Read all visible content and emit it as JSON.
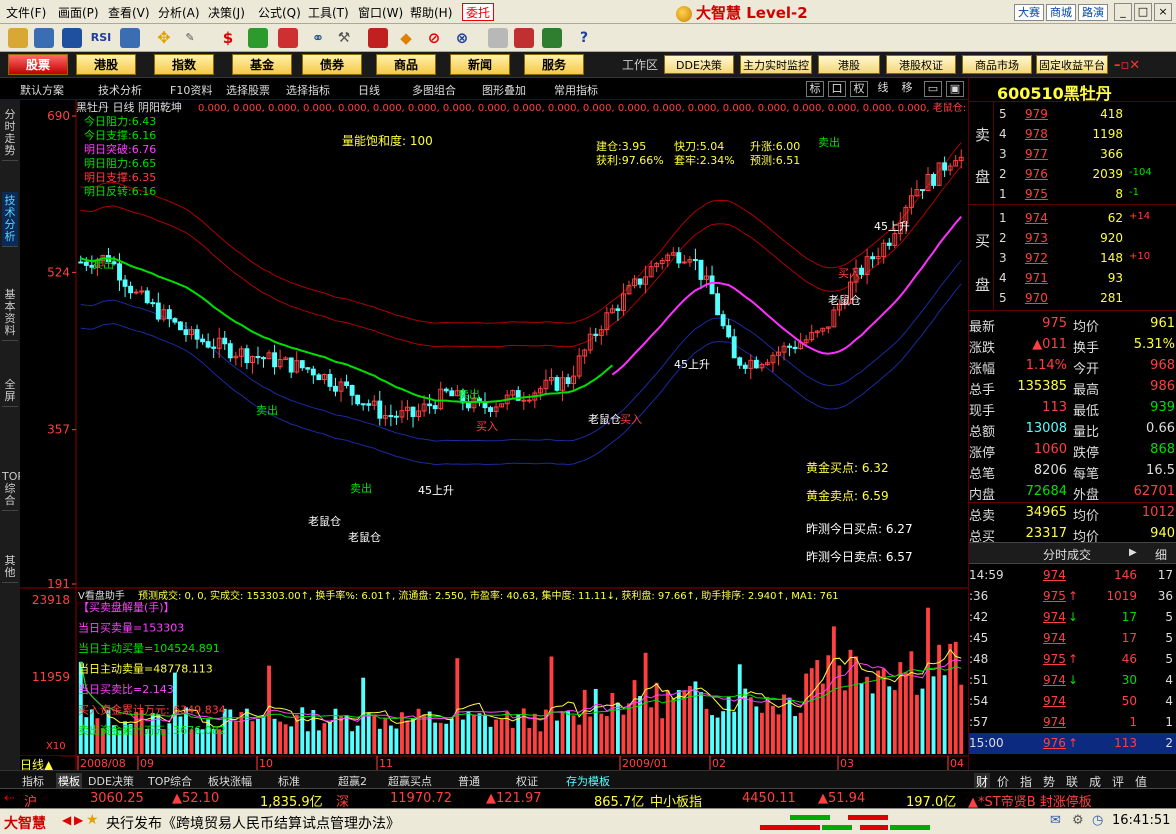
{
  "menu": {
    "items": [
      "文件(F)",
      "画面(P)",
      "查看(V)",
      "分析(A)",
      "决策(J)",
      "公式(Q)",
      "工具(T)",
      "窗口(W)",
      "帮助(H)"
    ],
    "weituo": "委托",
    "brand": "大智慧 Level-2",
    "top_buttons": [
      "大赛",
      "商城",
      "路演"
    ],
    "win_buttons": [
      "_",
      "□",
      "×"
    ]
  },
  "toolbar": {
    "icons": [
      "folder-icon",
      "chart-icon",
      "grid-icon",
      "rsi-icon",
      "calc-icon",
      "move-icon",
      "pen-icon",
      "dollar-icon",
      "eye-icon",
      "binoculars-icon",
      "hammer-icon",
      "alert-icon",
      "diamond-icon",
      "no-icon",
      "disk-icon",
      "copy-icon",
      "layout-icon",
      "books-icon",
      "help-icon"
    ],
    "rsi_label": "RSI",
    "dollar_label": "$"
  },
  "nav": {
    "buttons": [
      "股票",
      "港股",
      "指数",
      "基金",
      "债券",
      "商品",
      "新闻",
      "服务"
    ],
    "active": "股票",
    "workarea": "工作区",
    "buttons2": [
      "DDE决策",
      "主力实时监控",
      "港股",
      "港股权证",
      "商品市场",
      "固定收益平台"
    ]
  },
  "options": {
    "items": [
      "默认方案",
      "技术分析",
      "F10资料",
      "选择股票",
      "选择指标",
      "日线",
      "多图组合",
      "图形叠加",
      "常用指标"
    ],
    "right_buttons": [
      "标",
      "口",
      "权",
      "线",
      "移"
    ]
  },
  "left_tabs": [
    "分时走势",
    "技术分析",
    "基本资料",
    "全屏",
    "TOP综合",
    "其他"
  ],
  "left_tab_active": "技术分析",
  "chart_data": [
    {
      "type": "candlestick",
      "title": "黑牡丹 日线 阴阳乾坤",
      "header_values": "0.000, 0.000, 0.000, 0.000, 0.000, 0.000, 0.000, 0.000, 0.000, 0.000, 0.000, 0.000, 0.000, 0.000, 0.000, 0.000, 0.000, 0.000, 0.000, 0.000, 0.000, 老鼠仓: 0.000, 阴阳",
      "y_ticks": [
        690,
        524,
        357,
        191
      ],
      "ylim": [
        191,
        690
      ],
      "x_ticks": [
        "2008/08",
        "09",
        "10",
        "11",
        "2009/01",
        "02",
        "03",
        "04"
      ],
      "levels": [
        {
          "label": "今日阻力:",
          "value": "6.43",
          "color": "#00e000"
        },
        {
          "label": "今日支撑:",
          "value": "6.16",
          "color": "#00e000"
        },
        {
          "label": "明日突破:",
          "value": "6.76",
          "color": "#ff40ff"
        },
        {
          "label": "明日阻力:",
          "value": "6.65",
          "color": "#00e000"
        },
        {
          "label": "明日支撑:",
          "value": "6.35",
          "color": "#ff4040"
        },
        {
          "label": "明日反转:",
          "value": "6.16",
          "color": "#00e000"
        }
      ],
      "saturation": "量能饱和度: 100",
      "info_box": {
        "jiancang": "建仓:3.95",
        "kuaidao": "快刀:5.04",
        "shengzhang": "升涨:6.00",
        "huoli": "获利:97.66%",
        "taolao": "套牢:2.34%",
        "yuce": "预测:6.51"
      },
      "signals": {
        "sell": "卖出",
        "buy": "买入",
        "rat": "老鼠仓",
        "rise": "45上升"
      },
      "gold": {
        "buy": "黄金买点: 6.32",
        "sell": "黄金卖点: 6.59",
        "prev_buy": "昨测今日买点: 6.27",
        "prev_sell": "昨测今日卖点: 6.57"
      },
      "series_colors": {
        "up": "#ff4040",
        "down": "#54ffff",
        "ma_green": "#00e000",
        "ma_magenta": "#ff30ff",
        "band_red": "#b00000",
        "band_blue": "#1a2aa0"
      }
    },
    {
      "type": "bar",
      "title": "V看盘助手",
      "header": "预测成交: 0, 0, 实成交: 153303.00↑, 换手率%: 6.01↑, 流通盘: 2.550, 市盈率: 40.63, 集中度: 11.11↓, 获利盘: 97.66↑, 助手排序: 2.940↑, MA1: 761",
      "y_ticks": [
        23918,
        11959
      ],
      "ylim": [
        0,
        23918
      ],
      "scale_label": "X10",
      "lines": [
        {
          "text": "【买卖盘解量(手)】",
          "color": "#ff40ff"
        },
        {
          "text": "当日买卖量=153303",
          "color": "#ff40ff"
        },
        {
          "text": "当日主动买量=104524.891",
          "color": "#00e000"
        },
        {
          "text": "当日主动卖量=48778.113",
          "color": "#ffff40"
        },
        {
          "text": "当日买卖比=2.143",
          "color": "#ff40ff"
        },
        {
          "text": "买入资金累计万元: 6349.834",
          "color": "#ff4040"
        },
        {
          "text": "卖出资金累计万元: 3676.082",
          "color": "#00e000"
        }
      ]
    }
  ],
  "stock": {
    "code": "600510",
    "name": "黑牡丹"
  },
  "orderbook": {
    "sell_label": [
      "卖",
      "盘"
    ],
    "buy_label": [
      "买",
      "盘"
    ],
    "sells": [
      {
        "level": "5",
        "price": "979",
        "vol": "418",
        "chg": ""
      },
      {
        "level": "4",
        "price": "978",
        "vol": "1198",
        "chg": ""
      },
      {
        "level": "3",
        "price": "977",
        "vol": "366",
        "chg": ""
      },
      {
        "level": "2",
        "price": "976",
        "vol": "2039",
        "chg": "-104"
      },
      {
        "level": "1",
        "price": "975",
        "vol": "8",
        "chg": "-1"
      }
    ],
    "buys": [
      {
        "level": "1",
        "price": "974",
        "vol": "62",
        "chg": "+14"
      },
      {
        "level": "2",
        "price": "973",
        "vol": "920",
        "chg": ""
      },
      {
        "level": "3",
        "price": "972",
        "vol": "148",
        "chg": "+10"
      },
      {
        "level": "4",
        "price": "971",
        "vol": "93",
        "chg": ""
      },
      {
        "level": "5",
        "price": "970",
        "vol": "281",
        "chg": ""
      }
    ]
  },
  "quotes": [
    {
      "l1": "最新",
      "v1": "975",
      "c1": "#ff4040",
      "l2": "均价",
      "v2": "961",
      "c2": "#ffff40"
    },
    {
      "l1": "涨跌",
      "v1": "▲011",
      "c1": "#ff4040",
      "l2": "换手",
      "v2": "5.31%",
      "c2": "#ffff40"
    },
    {
      "l1": "涨幅",
      "v1": "1.14%",
      "c1": "#ff4040",
      "l2": "今开",
      "v2": "968",
      "c2": "#ff4040"
    },
    {
      "l1": "总手",
      "v1": "135385",
      "c1": "#ffff40",
      "l2": "最高",
      "v2": "986",
      "c2": "#ff4040"
    },
    {
      "l1": "现手",
      "v1": "113",
      "c1": "#ff4040",
      "l2": "最低",
      "v2": "939",
      "c2": "#00e000"
    },
    {
      "l1": "总额",
      "v1": "13008",
      "c1": "#54ffff",
      "l2": "量比",
      "v2": "0.66",
      "c2": "#ddd"
    },
    {
      "l1": "涨停",
      "v1": "1060",
      "c1": "#ff4040",
      "l2": "跌停",
      "v2": "868",
      "c2": "#00e000"
    },
    {
      "l1": "总笔",
      "v1": "8206",
      "c1": "#ddd",
      "l2": "每笔",
      "v2": "16.5",
      "c2": "#ddd"
    },
    {
      "l1": "内盘",
      "v1": "72684",
      "c1": "#00e000",
      "l2": "外盘",
      "v2": "62701",
      "c2": "#ff4040"
    },
    {
      "l1": "总卖",
      "v1": "34965",
      "c1": "#ffff40",
      "l2": "均价",
      "v2": "1012",
      "c2": "#ff4040"
    },
    {
      "l1": "总买",
      "v1": "23317",
      "c1": "#ffff40",
      "l2": "均价",
      "v2": "940",
      "c2": "#ffff40"
    }
  ],
  "trades": {
    "title": "分时成交",
    "title_btn": "细",
    "rows": [
      {
        "time": "14:59",
        "price": "974",
        "arrow": "",
        "vol": "146",
        "n": "17"
      },
      {
        "time": ":36",
        "price": "975",
        "arrow": "↑",
        "vol": "1019",
        "n": "36"
      },
      {
        "time": ":42",
        "price": "974",
        "arrow": "↓",
        "vol": "17",
        "n": "5"
      },
      {
        "time": ":45",
        "price": "974",
        "arrow": "",
        "vol": "17",
        "n": "5"
      },
      {
        "time": ":48",
        "price": "975",
        "arrow": "↑",
        "vol": "46",
        "n": "5"
      },
      {
        "time": ":51",
        "price": "974",
        "arrow": "↓",
        "vol": "30",
        "n": "4"
      },
      {
        "time": ":54",
        "price": "974",
        "arrow": "",
        "vol": "50",
        "n": "4"
      },
      {
        "time": ":57",
        "price": "974",
        "arrow": "",
        "vol": "1",
        "n": "1"
      },
      {
        "time": "15:00",
        "price": "976",
        "arrow": "↑",
        "vol": "113",
        "n": "2"
      }
    ]
  },
  "bottom_tabs": [
    "指标",
    "模板",
    "DDE决策",
    "TOP综合",
    "板块涨幅",
    "标准",
    "超赢2",
    "超赢买点",
    "普通",
    "权证",
    "存为模板"
  ],
  "right_bottom_tabs": [
    "财",
    "价",
    "指",
    "势",
    "联",
    "成",
    "评",
    "值"
  ],
  "status1": {
    "sh_label": "沪",
    "sh_index": "3060.25",
    "sh_chg": "▲52.10",
    "sh_amt": "1,835.9亿",
    "sz_label": "深",
    "sz_index": "11970.72",
    "sz_chg": "▲121.97",
    "sz_amt": "865.7亿",
    "zx_label": "中小板指",
    "zx_index": "4450.11",
    "zx_chg": "▲51.94",
    "zx_amt": "197.0亿",
    "news_tag": "▲*ST帝贤B 封涨停板"
  },
  "status2": {
    "logo": "大智慧",
    "ticker": "央行发布《跨境贸易人民币结算试点管理办法》",
    "time": "16:41:51"
  },
  "period_label": "日线"
}
